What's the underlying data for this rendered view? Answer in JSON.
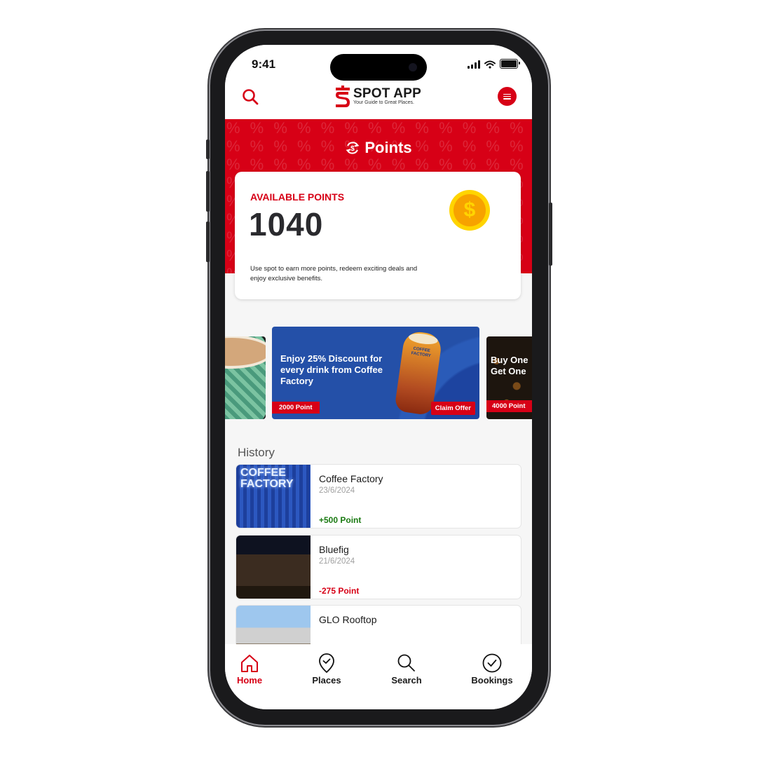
{
  "status_bar": {
    "time": "9:41"
  },
  "app_bar": {
    "logo_title": "SPOT APP",
    "logo_subtitle": "Your Guide to Great Places.",
    "icons": {
      "left": "search-icon",
      "right": "menu-icon"
    }
  },
  "hero": {
    "title": "Points",
    "title_icon": "points-exchange-icon",
    "pattern_glyph": "%"
  },
  "points_card": {
    "label": "AVAILABLE POINTS",
    "value": "1040",
    "description": "Use spot to earn more points, redeem exciting deals and enjoy exclusive benefits.",
    "icon": "coin-dollar-icon"
  },
  "offers": [
    {
      "title": "",
      "points": "",
      "partial": true
    },
    {
      "title": "Enjoy 25% Discount for every drink from Coffee Factory",
      "points": "2000 Point",
      "action": "Claim Offer",
      "brand_on_image": "COFFEE FACTORY"
    },
    {
      "title": "Buy One Get One",
      "points": "4000 Point",
      "partial": true
    }
  ],
  "history": {
    "title": "History",
    "items": [
      {
        "name": "Coffee Factory",
        "date": "23/6/2024",
        "points": "+500 Point",
        "type": "earn",
        "image_text": "COFFEE FACTORY"
      },
      {
        "name": "Bluefig",
        "date": "21/6/2024",
        "points": "-275 Point",
        "type": "spend"
      },
      {
        "name": "GLO Rooftop",
        "date": "",
        "points": "",
        "type": ""
      }
    ]
  },
  "tab_bar": {
    "tabs": [
      {
        "label": "Home",
        "icon": "home-icon",
        "active": true
      },
      {
        "label": "Places",
        "icon": "place-pin-check-icon",
        "active": false
      },
      {
        "label": "Search",
        "icon": "search-icon",
        "active": false
      },
      {
        "label": "Bookings",
        "icon": "check-circle-icon",
        "active": false
      }
    ]
  },
  "colors": {
    "brand_red": "#d70016",
    "earn_green": "#1a7a12",
    "offer_blue": "#2450a8",
    "coin_yellow": "#ffd400",
    "coin_orange": "#f7a200"
  }
}
